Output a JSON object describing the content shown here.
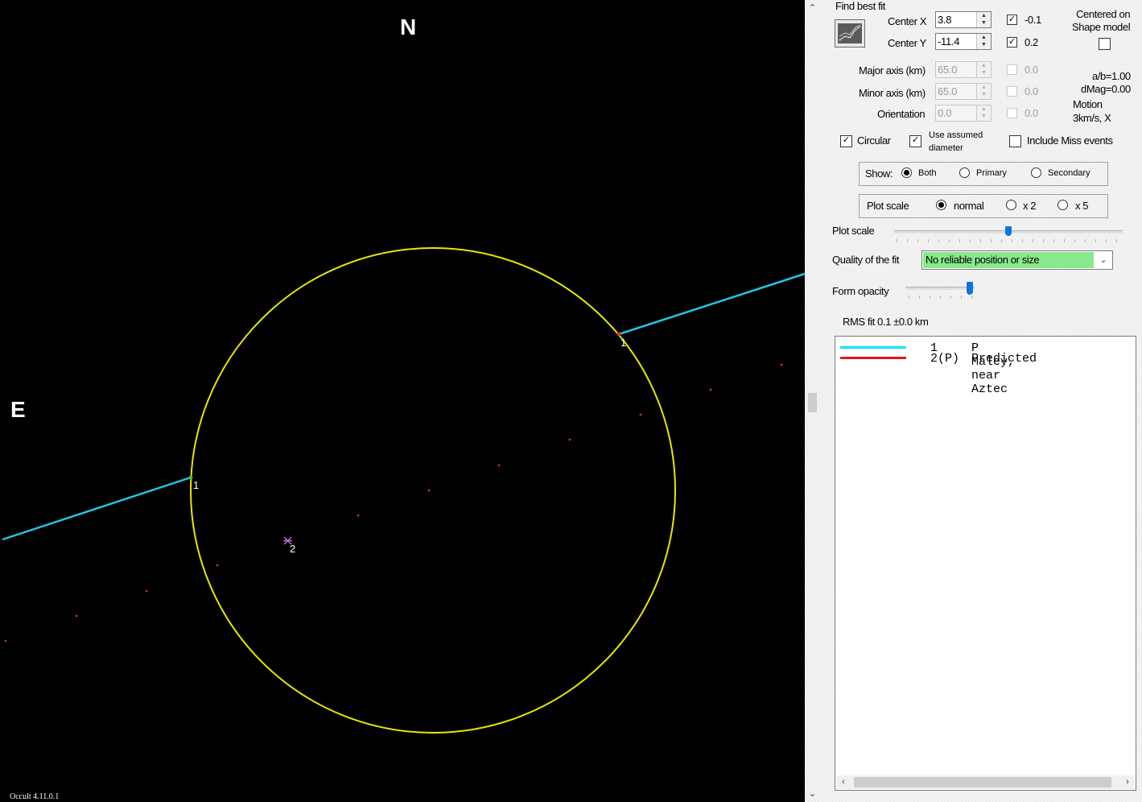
{
  "plot": {
    "north_label": "N",
    "east_label": "E",
    "version": "Occult 4.11.0.1",
    "chord_labels": [
      "1",
      "1",
      "2"
    ],
    "colors": {
      "background": "#000000",
      "ellipse": "#e8e800",
      "chord": "#1ec8e0",
      "predicted_dots": "#c03040",
      "label": "#ffffff"
    }
  },
  "panel": {
    "find_best_fit": "Find best fit",
    "center_x_label": "Center X",
    "center_x_value": "3.8",
    "center_y_label": "Center Y",
    "center_y_value": "-11.4",
    "step_x": "-0.1",
    "step_y": "0.2",
    "centered_on_shape_label": "Centered on\nShape model",
    "major_axis_label": "Major axis (km)",
    "major_axis_value": "65.0",
    "minor_axis_label": "Minor axis (km)",
    "minor_axis_value": "65.0",
    "orientation_label": "Orientation",
    "orientation_value": "0.0",
    "step_major": "0.0",
    "step_minor": "0.0",
    "step_orient": "0.0",
    "ab_ratio": "a/b=1.00",
    "dmag": "dMag=0.00",
    "motion_label": "Motion",
    "motion_value": "3km/s, X",
    "circular_label": "Circular",
    "use_assumed_label": "Use assumed\ndiameter",
    "include_miss_label": "Include Miss events",
    "show_label": "Show:",
    "show_options": [
      "Both",
      "Primary",
      "Secondary"
    ],
    "show_selected": "Both",
    "plot_scale_group_label": "Plot scale",
    "scale_options": [
      "normal",
      "x 2",
      "x 5"
    ],
    "scale_selected": "normal",
    "plot_scale_slider_label": "Plot scale",
    "plot_scale_slider_value": 0.5,
    "quality_label": "Quality of the fit",
    "quality_value": "No reliable position or size",
    "form_opacity_label": "Form opacity",
    "form_opacity_value": 0.93,
    "rms_fit": "RMS fit 0.1 ±0.0 km"
  },
  "legend": [
    {
      "number": "1",
      "text": "P Maley, near Aztec",
      "color": "#00e8f8"
    },
    {
      "number": "2(P)",
      "text": "Predicted",
      "color": "#e01818"
    }
  ]
}
